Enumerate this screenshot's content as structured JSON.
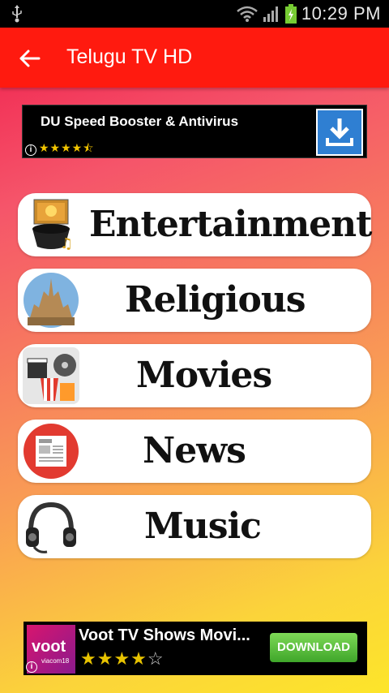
{
  "status_bar": {
    "time": "10:29 PM"
  },
  "app_bar": {
    "title": "Telugu TV HD",
    "back_icon": "arrow-left-icon"
  },
  "ad_top": {
    "title": "DU Speed Booster & Antivirus",
    "rating_stars": "★★★★⯪",
    "info": "i",
    "download_icon": "download-icon"
  },
  "categories": [
    {
      "label": "Entertainment",
      "icon": "entertainment-icon"
    },
    {
      "label": "Religious",
      "icon": "temple-icon"
    },
    {
      "label": "Movies",
      "icon": "movies-icon"
    },
    {
      "label": "News",
      "icon": "news-icon"
    },
    {
      "label": "Music",
      "icon": "headphones-icon"
    }
  ],
  "ad_bottom": {
    "title": "Voot TV Shows Movi...",
    "thumb_text": "voot",
    "thumb_sub": "viacom18",
    "stars_filled": "★★★★",
    "stars_empty": "☆",
    "info": "i",
    "button": "DOWNLOAD"
  },
  "colors": {
    "app_bar": "#ff1a0f",
    "status_bar": "#000000",
    "download_green": "#4caf3a"
  }
}
